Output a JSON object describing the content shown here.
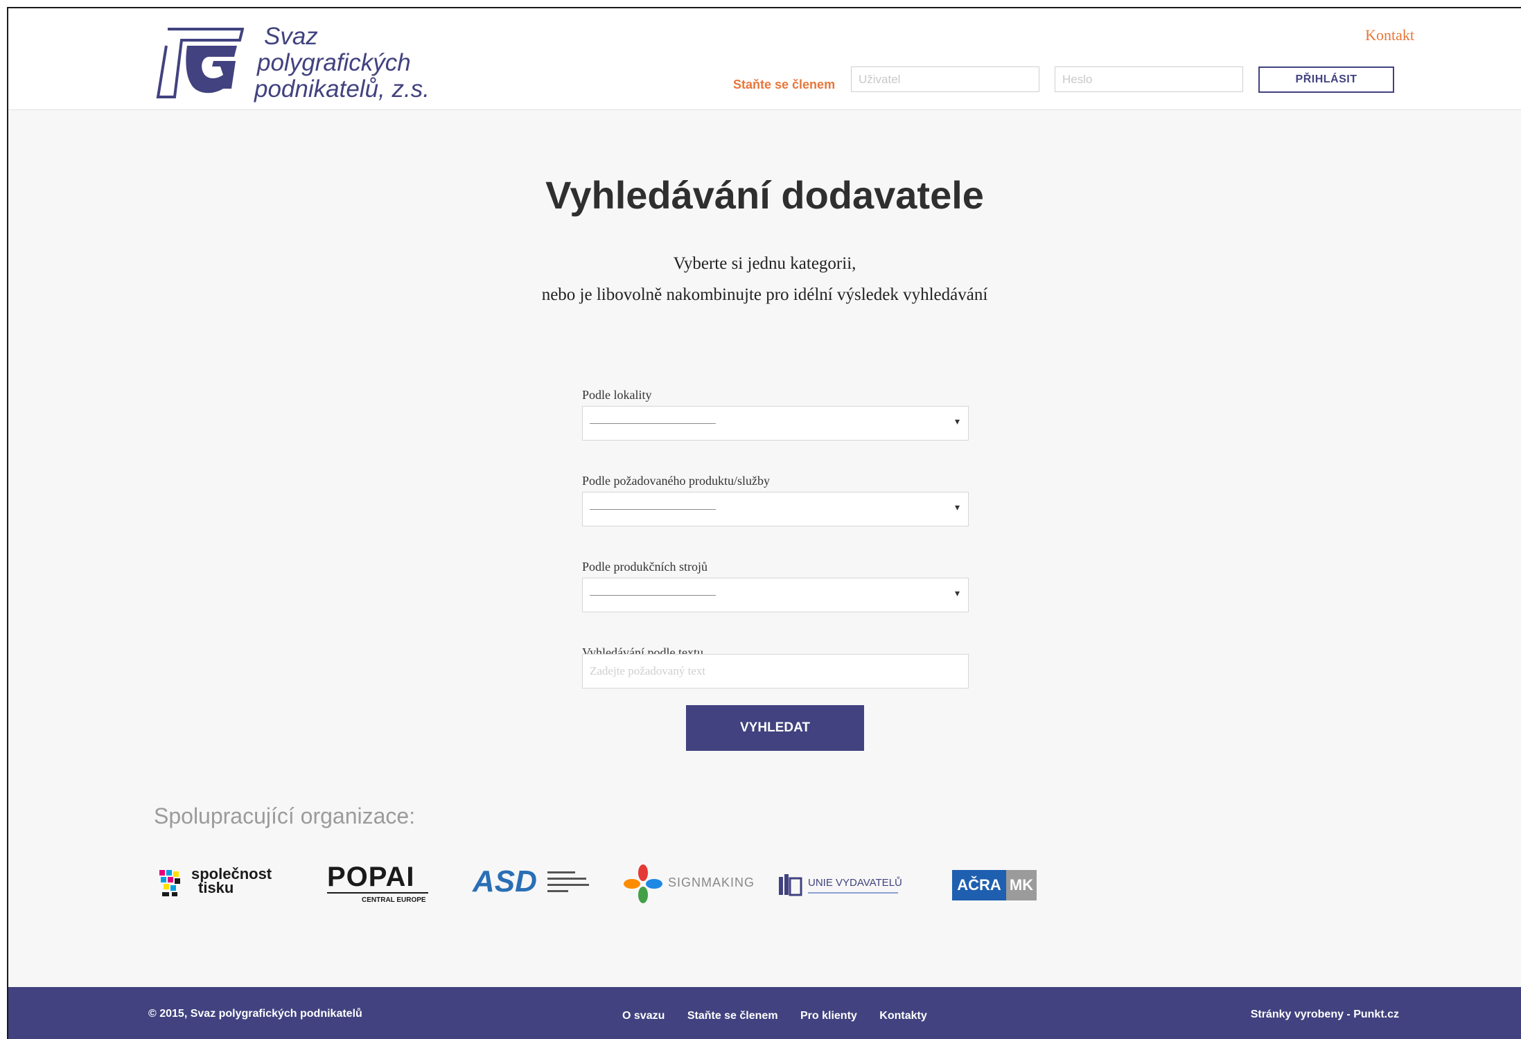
{
  "header": {
    "logo_lines": [
      "Svaz",
      "polygrafických",
      "podnikatelů, z.s."
    ],
    "contact_link": "Kontakt",
    "become_member": "Staňte se členem",
    "user_placeholder": "Uživatel",
    "password_placeholder": "Heslo",
    "login_button": "PŘIHLÁSIT"
  },
  "main": {
    "title": "Vyhledávání dodavatele",
    "subtitle_lines": [
      "Vyberte si jednu kategorii,",
      "nebo je libovolně nakombinujte pro idélní výsledek vyhledávání"
    ],
    "fields": [
      {
        "label": "Podle lokality"
      },
      {
        "label": "Podle požadovaného produktu/služby"
      },
      {
        "label": "Podle produkčních strojů"
      }
    ],
    "text_search": {
      "label": "Vyhledávání podle textu",
      "placeholder": "Zadejte požadovaný text"
    },
    "search_button": "VYHLEDAT"
  },
  "partners": {
    "heading": "Spolupracující organizace:",
    "logos": [
      {
        "name": "společnost tisku",
        "lines": [
          "společnost",
          "tisku"
        ]
      },
      {
        "name": "POPAI",
        "text": "POPAI",
        "sub": "CENTRAL EUROPE"
      },
      {
        "name": "ASD",
        "text": "ASD"
      },
      {
        "name": "SIGNMAKING",
        "text": "SIGNMAKING"
      },
      {
        "name": "UNIE VYDAVATELŮ",
        "text": "UNIE VYDAVATELŮ"
      },
      {
        "name": "AČRA MK",
        "text1": "AČRA",
        "text2": "MK"
      }
    ]
  },
  "footer": {
    "copyright": "© 2015, Svaz polygrafických podnikatelů",
    "links": [
      "O svazu",
      "Staňte se členem",
      "Pro klienty",
      "Kontakty"
    ],
    "credit": "Stránky vyrobeny - Punkt.cz"
  },
  "colors": {
    "brand": "#41427f",
    "accent": "#e8763a",
    "background": "#f7f7f7"
  }
}
